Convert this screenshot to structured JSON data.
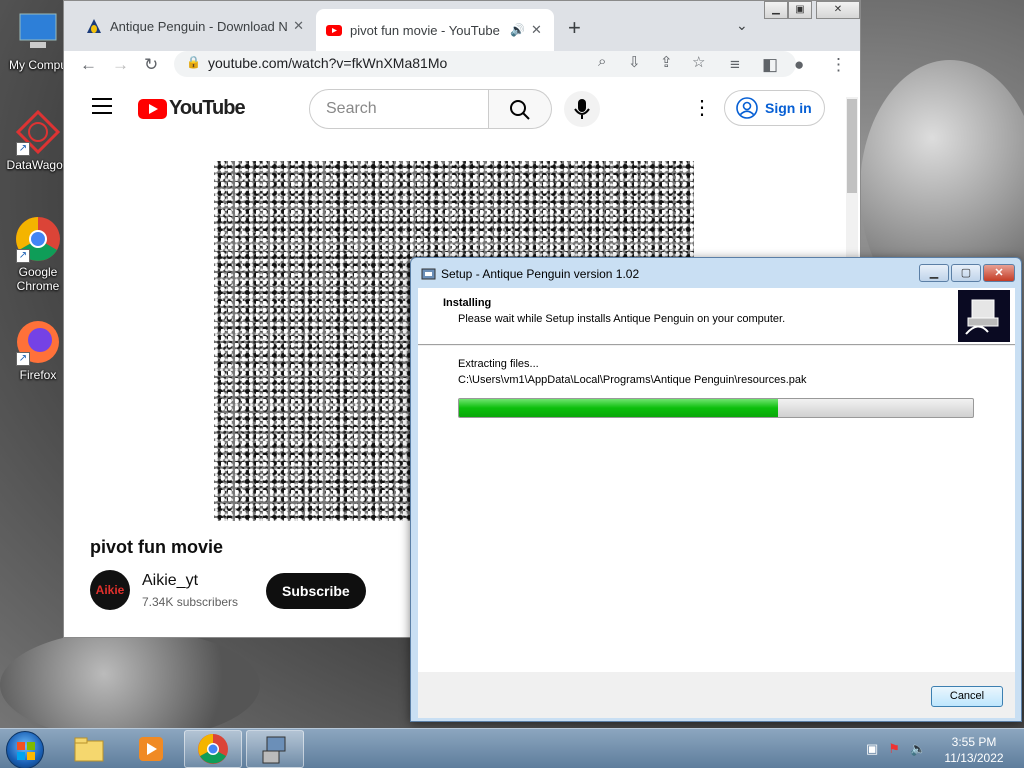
{
  "desktop": {
    "icons": [
      {
        "label": "My Compu",
        "icon": "computer-icon"
      },
      {
        "label": "DataWagon",
        "icon": "datawagon-icon"
      },
      {
        "label": "Google Chrome",
        "icon": "chrome-icon"
      },
      {
        "label": "Firefox",
        "icon": "firefox-icon"
      }
    ]
  },
  "browser": {
    "tabs": [
      {
        "title": "Antique Penguin - Download No",
        "icon": "penguin-favicon",
        "active": false
      },
      {
        "title": "pivot fun movie - YouTube",
        "icon": "youtube-favicon",
        "active": true,
        "audio": true
      }
    ],
    "url": "youtube.com/watch?v=fkWnXMa81Mo"
  },
  "youtube": {
    "logo_text": "YouTube",
    "search_placeholder": "Search",
    "signin_label": "Sign in",
    "video_title": "pivot fun movie",
    "channel_name": "Aikie_yt",
    "avatar_text": "Aikie",
    "subscribers": "7.34K subscribers",
    "subscribe_label": "Subscribe"
  },
  "setup": {
    "title": "Setup - Antique Penguin version 1.02",
    "heading": "Installing",
    "subheading": "Please wait while Setup installs Antique Penguin on your computer.",
    "status": "Extracting files...",
    "path": "C:\\Users\\vm1\\AppData\\Local\\Programs\\Antique Penguin\\resources.pak",
    "progress_percent": 62,
    "cancel_label": "Cancel"
  },
  "taskbar": {
    "time": "3:55 PM",
    "date": "11/13/2022",
    "items": [
      "explorer-icon",
      "media-player-icon",
      "chrome-icon",
      "setup-icon"
    ]
  },
  "colors": {
    "youtube_red": "#ff0000",
    "progress_green": "#0cbf0c",
    "signin_blue": "#065fd4"
  }
}
